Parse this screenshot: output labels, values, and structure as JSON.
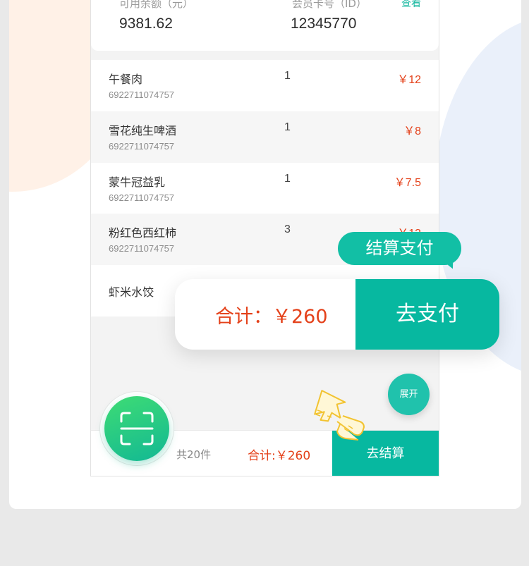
{
  "balance": {
    "amount_label": "可用余额（元）",
    "amount_value": "9381.62",
    "card_label": "会员卡号（ID）",
    "card_value": "12345770",
    "view_link": "查看"
  },
  "items": [
    {
      "name": "午餐肉",
      "code": "6922711074757",
      "qty": "1",
      "price": "￥12"
    },
    {
      "name": "雪花纯生啤酒",
      "code": "6922711074757",
      "qty": "1",
      "price": "￥8"
    },
    {
      "name": "蒙牛冠益乳",
      "code": "6922711074757",
      "qty": "1",
      "price": "￥7.5"
    },
    {
      "name": "粉红色西红柿",
      "code": "6922711074757",
      "qty": "3",
      "price": "￥13"
    },
    {
      "name": "虾米水饺"
    }
  ],
  "expand_label": "展开",
  "bottom_bar": {
    "count": "共20件",
    "total": "合计:￥260",
    "checkout_label": "去结算"
  },
  "callout": {
    "bubble_label": "结算支付",
    "total": "合计：￥260",
    "pay_label": "去支付"
  },
  "icons": {
    "scan": "scan-icon",
    "pointer": "hand-pointer-icon"
  },
  "colors": {
    "accent": "#07b8a0",
    "price": "#e4411a",
    "scan_gradient_top": "#3edc74",
    "scan_gradient_bottom": "#12b894"
  }
}
